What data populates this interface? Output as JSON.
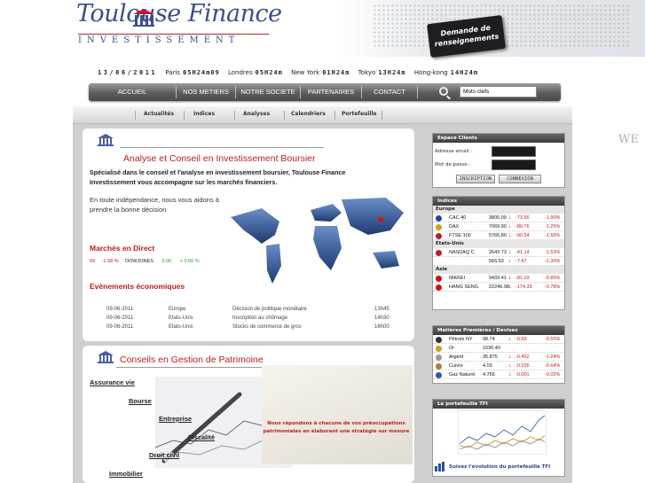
{
  "header": {
    "logo_main": "Toulouse  Finance",
    "logo_sub": "INVESTISSEMENT",
    "demande_label": "Demande de renseignements",
    "welcome_fragment": "WE"
  },
  "ticker": {
    "date": "13/06/2011",
    "cities": [
      {
        "city": "Paris",
        "time": "05H24m09"
      },
      {
        "city": "Londres",
        "time": "05H24m"
      },
      {
        "city": "New York",
        "time": "01H24m"
      },
      {
        "city": "Tokyo",
        "time": "13H24m"
      },
      {
        "city": "Hong-kong",
        "time": "14H24m"
      }
    ]
  },
  "nav": {
    "items": [
      "ACCUEIL",
      "NOS METIERS",
      "NOTRE SOCIETE",
      "PARTENAIRES",
      "CONTACT"
    ],
    "search_value": "Mots clefs"
  },
  "subnav": [
    "Actualités",
    "Indices",
    "Analyses",
    "Calendriers",
    "Portefeuille"
  ],
  "analyse": {
    "title": "Analyse et Conseil en Investissement Boursier",
    "intro": "Spécialisé dans le conseil et l'analyse en investissement boursier, Toulouse Finance Investissement vous accompagne sur les marchés financiers.",
    "tagline": "En toute indépendance, nous vous aidons à prendre la bonne décision",
    "marches_title": "Marchés en Direct",
    "marches_line": {
      "a": "09",
      "b": "-1.58 %",
      "c": "DOWJONES",
      "d": "0.00",
      "e": "+ 0.00 %"
    },
    "events_title": "Evènements économiques",
    "events": [
      {
        "date": "09-06-2011",
        "zone": "Europe",
        "event": "Décision de politique monétaire",
        "time": "13h45"
      },
      {
        "date": "09-06-2011",
        "zone": "Etats-Unis",
        "event": "Inscription au chômage",
        "time": "14h30"
      },
      {
        "date": "09-06-2011",
        "zone": "Etats-Unis",
        "event": "Stocks de commerce de gros",
        "time": "16h00"
      }
    ]
  },
  "patrimoine": {
    "title": "Conseils en Gestion de Patrimoine",
    "links": [
      "Assurance vie",
      "Bourse",
      "Entreprise",
      "Fiscalité",
      "Droit civil",
      "Immobilier"
    ],
    "note": "Nous répondons à chacune de vos préoccupations patrimoniales en élaborant une stratégie sur mesure"
  },
  "espace": {
    "title": "Espace Clients",
    "email_label": "Adresse email :",
    "password_label": "Mot de passe :",
    "inscription_label": "INSCRIPTION",
    "connexion_label": "CONNEXION"
  },
  "indices": {
    "title": "Indices",
    "groups": [
      {
        "name": "Europe",
        "rows": [
          {
            "name": "CAC 40",
            "value": "3805.09",
            "change": "-73.56",
            "pct": "-1.90%",
            "flag": "#2244aa"
          },
          {
            "name": "DAX",
            "value": "7069.90",
            "change": "-89.76",
            "pct": "-1.25%",
            "flag": "#d4a017"
          },
          {
            "name": "FTSE 100",
            "value": "5765.80",
            "change": "-90.54",
            "pct": "-1.55%",
            "flag": "#b22234"
          }
        ]
      },
      {
        "name": "Etats-Unis",
        "rows": [
          {
            "name": "NASDAQ C",
            "value": "2643.73",
            "change": "-41.14",
            "pct": "-1.53%",
            "flag": "#b22234"
          },
          {
            "name": "",
            "value": "566.53",
            "change": "-7.47",
            "pct": "-1.30%",
            "flag": ""
          }
        ]
      },
      {
        "name": "Asie",
        "rows": [
          {
            "name": "NIKKEI",
            "value": "9433.41",
            "change": "-81.03",
            "pct": "-0.85%",
            "flag": "#cc1111"
          },
          {
            "name": "HANG SENG",
            "value": "22246.98",
            "change": "-174.39",
            "pct": "-0.78%",
            "flag": "#cc1111"
          }
        ]
      }
    ]
  },
  "matieres": {
    "title": "Matières Premières / Devises",
    "rows": [
      {
        "name": "Pétrole NY",
        "value": "98.74",
        "change": "-0.55",
        "pct": "-0.55%",
        "color": "#333"
      },
      {
        "name": "Or",
        "value": "1530.40",
        "change": "",
        "pct": "",
        "color": "#d4a017"
      },
      {
        "name": "Argent",
        "value": "35.875",
        "change": "-0.452",
        "pct": "-1.24%",
        "color": "#999"
      },
      {
        "name": "Cuivre",
        "value": "4.03",
        "change": "-0.026",
        "pct": "-0.64%",
        "color": "#b8733a"
      },
      {
        "name": "Gaz Naturel",
        "value": "4.756",
        "change": "-0.001",
        "pct": "-0.02%",
        "color": "#3355aa"
      }
    ]
  },
  "portefeuille": {
    "title": "Le portefeuille TFI",
    "caption": "Suivez l'évolution du portefeuille TFI"
  }
}
